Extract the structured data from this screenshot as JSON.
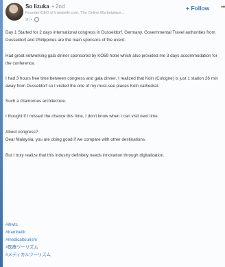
{
  "post": {
    "author": {
      "name": "So Iizuka",
      "degree": "• 2nd",
      "headline": "Founder/CEO of trambellir.com, The Online Marketplace...",
      "time": "9h •"
    },
    "follow_label": "+ Follow",
    "more_label": "•••",
    "paragraphs": [
      "Day 1 Started for 2 days international congress in Dusseldorf, Germany. Governmental Travel authorities from Dusseldorf and Philippines are the main sponsors of the event.",
      "Had great networking gala dinner sponsored by KO59 hotel which also provided me 3 days accommodation for the conference.",
      "I had 3 hours free time between congress and gala dinner, I realized that Koln (Cologne) is just 1 station 26 min away from Dusseldorf so I visited the one of my must-see places Koln cathedral.",
      "Such a Glamorous architecture.",
      "I thought If I missed the chance this time, I don't know when I can visit next time.",
      "About congress?\nDear Malaysia, you are doing good if we compare with other destinations.",
      "But I truly realize that this industry definitely needs innovation through digitalization."
    ],
    "hashtags": [
      "#ihwtc",
      "#trambellir",
      "#medicaltourism",
      "#医療ツーリズム",
      "#メディカルツーリズム"
    ]
  }
}
